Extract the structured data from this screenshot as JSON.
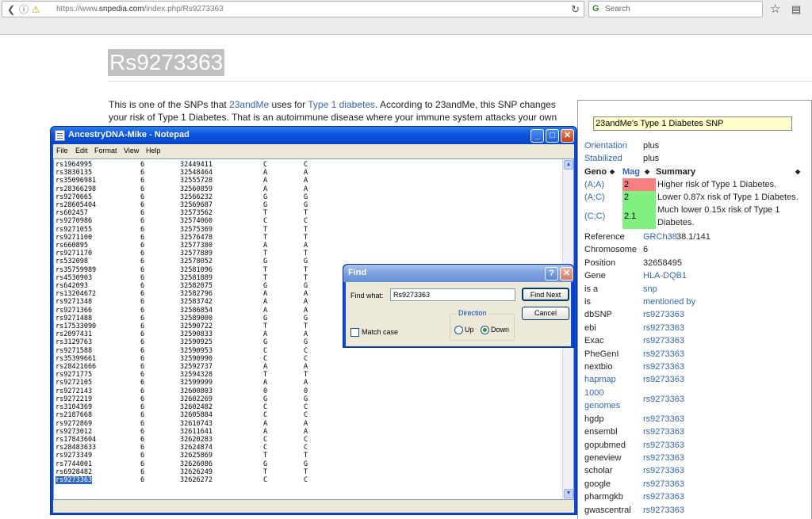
{
  "browser": {
    "url_prefix": "https://www.",
    "url_domain": "snpedia.com",
    "url_path": "/index.php/Rs9273363",
    "search_placeholder": "Search"
  },
  "page": {
    "title": "Rs9273363",
    "intro": {
      "t1": "This is one of the SNPs that ",
      "link1": "23andMe",
      "t2": " uses for ",
      "link2": "Type 1 diabetes",
      "t3": ". According to 23andMe, this SNP changes your risk of Type 1 Diabetes. That is an autoimmune disease where your immune system attacks your own body's"
    }
  },
  "infobox": {
    "header": "23andMe's Type 1 Diabetes SNP",
    "orientation_label": "Orientation",
    "orientation_value": "plus",
    "stabilized_label": "Stabilized",
    "stabilized_value": "plus",
    "col_geno": "Geno",
    "col_mag": "Mag",
    "col_summary": "Summary",
    "genotypes": [
      {
        "geno": "(A;A)",
        "mag": "2",
        "summary": "Higher risk of Type 1 Diabetes.",
        "color": "#f88080"
      },
      {
        "geno": "(A;C)",
        "mag": "2",
        "summary": "Lower 0.87x risk of Type 1 Diabetes.",
        "color": "#80f080"
      },
      {
        "geno": "(C;C)",
        "mag": "2.1",
        "summary": "Much lower 0.15x risk of Type 1 Diabetes.",
        "color": "#80f080"
      }
    ],
    "fields": [
      {
        "label": "Reference",
        "value": "GRCh38",
        "extra": "38.1/141",
        "link": true
      },
      {
        "label": "Chromosome",
        "value": "6",
        "link": false
      },
      {
        "label": "Position",
        "value": "32658495",
        "link": false
      },
      {
        "label": "Gene",
        "value": "HLA-DQB1",
        "link": true
      },
      {
        "label": "is a",
        "value": "snp",
        "link": true
      },
      {
        "label": "is",
        "value": "mentioned by",
        "link": true
      },
      {
        "label": "dbSNP",
        "value": "rs9273363",
        "link": true
      },
      {
        "label": "ebi",
        "value": "rs9273363",
        "link": true
      },
      {
        "label": "Exac",
        "value": "rs9273363",
        "link": true
      },
      {
        "label": "PheGenI",
        "value": "rs9273363",
        "link": true
      },
      {
        "label": "nextbio",
        "value": "rs9273363",
        "link": true
      },
      {
        "label": "hapmap",
        "value": "rs9273363",
        "link": true,
        "label_link": true
      },
      {
        "label": "1000 genomes",
        "value": "rs9273363",
        "link": true,
        "label_link": true,
        "tall": true
      },
      {
        "label": "hgdp",
        "value": "rs9273363",
        "link": true
      },
      {
        "label": "ensembl",
        "value": "rs9273363",
        "link": true
      },
      {
        "label": "gopubmed",
        "value": "rs9273363",
        "link": true
      },
      {
        "label": "geneview",
        "value": "rs9273363",
        "link": true
      },
      {
        "label": "scholar",
        "value": "rs9273363",
        "link": true
      },
      {
        "label": "google",
        "value": "rs9273363",
        "link": true
      },
      {
        "label": "pharmgkb",
        "value": "rs9273363",
        "link": true
      },
      {
        "label": "gwascentral",
        "value": "rs9273363",
        "link": true
      }
    ]
  },
  "notepad": {
    "title": "AncestryDNA-Mike - Notepad",
    "menus": [
      "File",
      "Edit",
      "Format",
      "View",
      "Help"
    ],
    "rows": [
      [
        "rs1964995",
        "6",
        "32449411",
        "C",
        "C"
      ],
      [
        "rs3830135",
        "6",
        "32548464",
        "A",
        "A"
      ],
      [
        "rs35096981",
        "6",
        "32555728",
        "A",
        "A"
      ],
      [
        "rs28366298",
        "6",
        "32560859",
        "A",
        "A"
      ],
      [
        "rs9270665",
        "6",
        "32566232",
        "G",
        "G"
      ],
      [
        "rs28605404",
        "6",
        "32569687",
        "G",
        "G"
      ],
      [
        "rs602457",
        "6",
        "32573562",
        "T",
        "T"
      ],
      [
        "rs9270986",
        "6",
        "32574060",
        "C",
        "C"
      ],
      [
        "rs9271055",
        "6",
        "32575369",
        "T",
        "T"
      ],
      [
        "rs9271100",
        "6",
        "32576478",
        "T",
        "T"
      ],
      [
        "rs660895",
        "6",
        "32577380",
        "A",
        "A"
      ],
      [
        "rs9271170",
        "6",
        "32577889",
        "T",
        "T"
      ],
      [
        "rs532098",
        "6",
        "32578052",
        "G",
        "G"
      ],
      [
        "rs35759989",
        "6",
        "32581096",
        "T",
        "T"
      ],
      [
        "rs4530903",
        "6",
        "32581889",
        "T",
        "T"
      ],
      [
        "rs642093",
        "6",
        "32582075",
        "G",
        "G"
      ],
      [
        "rs13204672",
        "6",
        "32582796",
        "A",
        "A"
      ],
      [
        "rs9271348",
        "6",
        "32583742",
        "A",
        "A"
      ],
      [
        "rs9271366",
        "6",
        "32586854",
        "A",
        "A"
      ],
      [
        "rs9271488",
        "6",
        "32589000",
        "G",
        "G"
      ],
      [
        "rs17533090",
        "6",
        "32590722",
        "T",
        "T"
      ],
      [
        "rs2097431",
        "6",
        "32590833",
        "A",
        "A"
      ],
      [
        "rs3129763",
        "6",
        "32590925",
        "G",
        "G"
      ],
      [
        "rs9271588",
        "6",
        "32590953",
        "C",
        "C"
      ],
      [
        "rs35399661",
        "6",
        "32590990",
        "C",
        "C"
      ],
      [
        "rs28421666",
        "6",
        "32592737",
        "A",
        "A"
      ],
      [
        "rs9271775",
        "6",
        "32594328",
        "T",
        "T"
      ],
      [
        "rs9272105",
        "6",
        "32599999",
        "A",
        "A"
      ],
      [
        "rs9272143",
        "6",
        "32600803",
        "0",
        "0"
      ],
      [
        "rs9272219",
        "6",
        "32602269",
        "G",
        "G"
      ],
      [
        "rs3104369",
        "6",
        "32602482",
        "C",
        "C"
      ],
      [
        "rs2187668",
        "6",
        "32605884",
        "C",
        "C"
      ],
      [
        "rs9272869",
        "6",
        "32610743",
        "A",
        "A"
      ],
      [
        "rs9273012",
        "6",
        "32611641",
        "A",
        "A"
      ],
      [
        "rs17843604",
        "6",
        "32620283",
        "C",
        "C"
      ],
      [
        "rs28483633",
        "6",
        "32624874",
        "C",
        "C"
      ],
      [
        "rs9273349",
        "6",
        "32625869",
        "T",
        "T"
      ],
      [
        "rs7744001",
        "6",
        "32626086",
        "G",
        "G"
      ],
      [
        "rs6928482",
        "6",
        "32626249",
        "T",
        "T"
      ],
      [
        "rs9273363",
        "6",
        "32626272",
        "C",
        "C"
      ]
    ],
    "selected_row": 39
  },
  "find": {
    "title": "Find",
    "find_what_label": "Find what:",
    "find_what_value": "Rs9273363",
    "find_next_label": "Find Next",
    "cancel_label": "Cancel",
    "direction_label": "Direction",
    "up_label": "Up",
    "down_label": "Down",
    "match_case_label": "Match case",
    "direction": "Down"
  }
}
